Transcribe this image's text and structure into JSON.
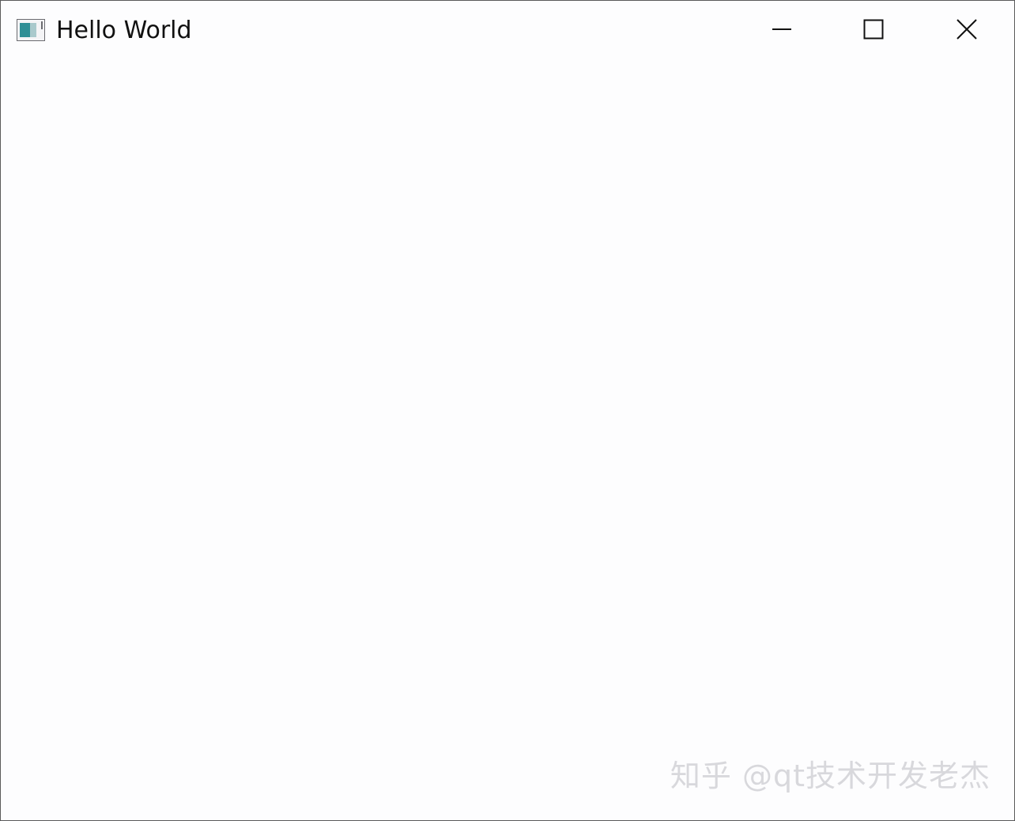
{
  "window": {
    "title": "Hello World",
    "icon": "app-window-icon",
    "controls": {
      "minimize_icon": "minimize-icon",
      "maximize_icon": "maximize-icon",
      "close_icon": "close-icon"
    }
  },
  "watermark": {
    "text": "知乎 @qt技术开发老杰"
  },
  "colors": {
    "background": "#fdfdfe",
    "title_text": "#111111",
    "icon_teal": "#2f8f96",
    "watermark": "#d8d8dc"
  }
}
